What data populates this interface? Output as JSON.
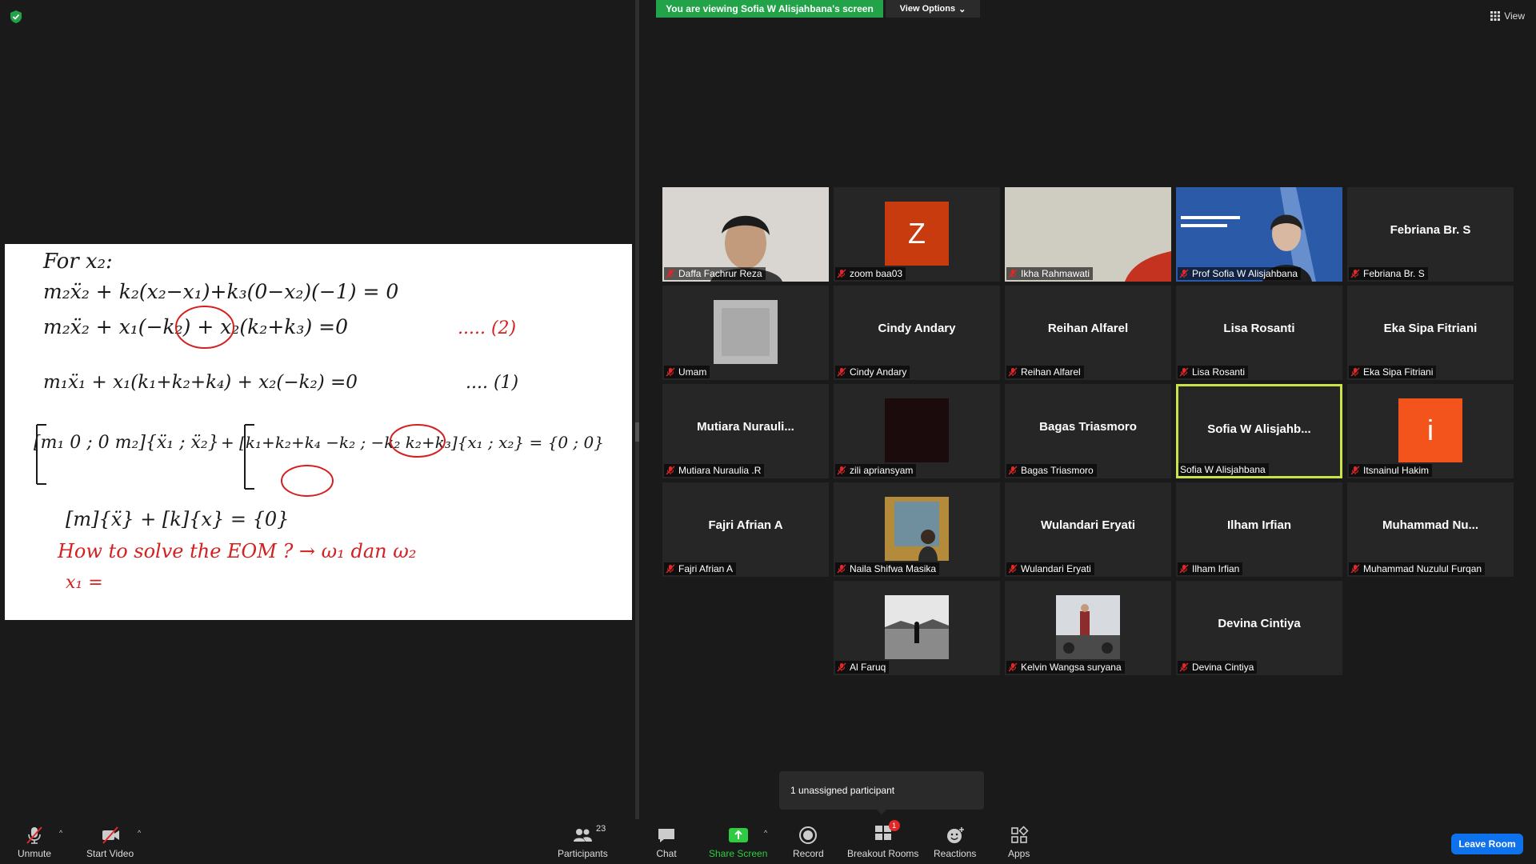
{
  "top": {
    "banner": "You are viewing Sofia W Alisjahbana's screen",
    "view_options": "View Options",
    "view": "View"
  },
  "whiteboard": {
    "line1": "For x₂:",
    "line2": "m₂ẍ₂ + k₂(x₂−x₁)+k₃(0−x₂)(−1) = 0",
    "line3": "m₂ẍ₂ + x₁(−k₂) + x₂(k₂+k₃) =0",
    "line3_tag": "..... (2)",
    "line4": "m₁ẍ₁ + x₁(k₁+k₂+k₄) + x₂(−k₂) =0",
    "line4_tag": ".... (1)",
    "matrix_m": "[m₁ 0 ; 0 m₂]{ẍ₁ ; ẍ₂}",
    "matrix_k": "+ [k₁+k₂+k₄  −k₂ ; −k₂  k₂+k₃]{x₁ ; x₂} = {0 ; 0}",
    "line6": "[m]{ẍ} + [k]{x} = {0}",
    "line7": "How to solve the EOM ? → ω₁ dan ω₂",
    "line8": "x₁ ="
  },
  "participants": [
    {
      "name": "Daffa Fachrur Reza",
      "display": "",
      "type": "photo",
      "photo": "face"
    },
    {
      "name": "zoom baa03",
      "display": "",
      "type": "letter",
      "letter": "Z",
      "color": "#c73b0f"
    },
    {
      "name": "Ikha Rahmawati",
      "display": "",
      "type": "photo",
      "photo": "wall"
    },
    {
      "name": "Prof Sofia W Alisjahbana",
      "display": "",
      "type": "photo",
      "photo": "prof"
    },
    {
      "name": "Febriana Br. S",
      "display": "Febriana Br. S",
      "type": "name"
    },
    {
      "name": "Umam",
      "display": "",
      "type": "thumb",
      "thumb": "blur"
    },
    {
      "name": "Cindy Andary",
      "display": "Cindy Andary",
      "type": "name"
    },
    {
      "name": "Reihan Alfarel",
      "display": "Reihan Alfarel",
      "type": "name"
    },
    {
      "name": "Lisa Rosanti",
      "display": "Lisa Rosanti",
      "type": "name"
    },
    {
      "name": "Eka Sipa Fitriani",
      "display": "Eka Sipa Fitriani",
      "type": "name"
    },
    {
      "name": "Mutiara Nuraulia .R",
      "display": "Mutiara  Nurauli...",
      "type": "name"
    },
    {
      "name": "zili apriansyam",
      "display": "",
      "type": "thumb",
      "thumb": "dark"
    },
    {
      "name": "Bagas Triasmoro",
      "display": "Bagas Triasmoro",
      "type": "name"
    },
    {
      "name": "Sofia W Alisjahbana",
      "display": "Sofia  W  Alisjahb...",
      "type": "name",
      "active": true,
      "unmuted": true
    },
    {
      "name": "Itsnainul Hakim",
      "display": "",
      "type": "letter",
      "letter": "i",
      "color": "#f2541b"
    },
    {
      "name": "Fajri Afrian A",
      "display": "Fajri Afrian A",
      "type": "name"
    },
    {
      "name": "Naila Shifwa Masika",
      "display": "",
      "type": "thumb",
      "thumb": "painting"
    },
    {
      "name": "Wulandari Eryati",
      "display": "Wulandari Eryati",
      "type": "name"
    },
    {
      "name": "Ilham Irfian",
      "display": "Ilham Irfian",
      "type": "name"
    },
    {
      "name": "Muhammad Nuzulul Furqan",
      "display": "Muhammad  Nu...",
      "type": "name"
    },
    {
      "name": "",
      "type": "empty"
    },
    {
      "name": "Al Faruq",
      "display": "",
      "type": "thumb",
      "thumb": "lake"
    },
    {
      "name": "Kelvin Wangsa suryana",
      "display": "",
      "type": "thumb",
      "thumb": "car"
    },
    {
      "name": "Devina Cintiya",
      "display": "Devina Cintiya",
      "type": "name"
    }
  ],
  "popup": {
    "unassigned": "1 unassigned participant"
  },
  "toolbar": {
    "unmute": "Unmute",
    "start_video": "Start Video",
    "participants": "Participants",
    "participants_count": "23",
    "chat": "Chat",
    "share_screen": "Share Screen",
    "record": "Record",
    "breakout_rooms": "Breakout Rooms",
    "breakout_badge": "1",
    "reactions": "Reactions",
    "apps": "Apps",
    "leave_room": "Leave Room"
  },
  "colors": {
    "banner": "#22a34a",
    "active_border": "#cde24a",
    "leave": "#0e72ed",
    "share_green": "#2ecc40"
  }
}
